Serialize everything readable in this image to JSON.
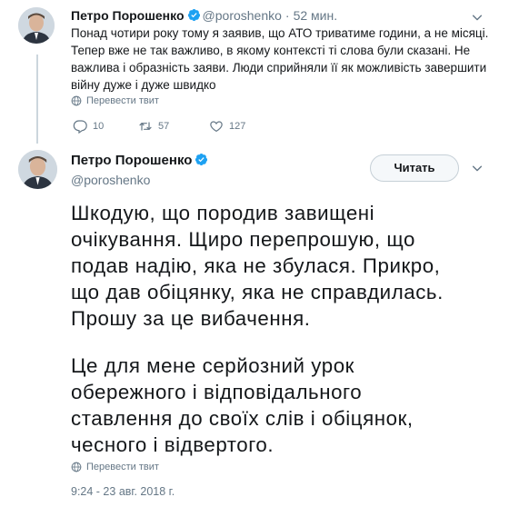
{
  "reply_tweet": {
    "author_name": "Петро Порошенко",
    "handle": "@poroshenko",
    "separator": "·",
    "time_ago": "52 мин.",
    "text_lines": [
      "Понад чотири року тому я заявив, що АТО триватиме години, а не місяці.",
      "Тепер вже не так важливо, в якому контексті ті слова були сказані. Не",
      "важлива і образність заяви. Люди сприйняли її як можливість завершити",
      "війну дуже і дуже швидко"
    ],
    "translate_label": "Перевести твит",
    "reply_count": "10",
    "retweet_count": "57",
    "like_count": "127"
  },
  "main_tweet": {
    "author_name": "Петро Порошенко",
    "handle": "@poroshenko",
    "follow_label": "Читать",
    "paragraph1_lines": [
      "Шкодую, що породив завищені",
      "очікування. Щиро перепрошую, що",
      "подав надію, яка не збулася. Прикро,",
      "що дав обіцянку, яка не справдилась.",
      "Прошу за це вибачення."
    ],
    "paragraph2_lines": [
      "Це для мене серйозний урок",
      "обережного і відповідального",
      "ставлення до своїх слів і обіцянок,",
      "чесного і відвертого."
    ],
    "translate_label": "Перевести твит",
    "timestamp": "9:24 - 23 авг. 2018 г."
  },
  "icons": {
    "verified": "verified-badge-icon",
    "chevron": "chevron-down-icon",
    "reply": "reply-icon",
    "retweet": "retweet-icon",
    "like": "heart-icon",
    "globe": "globe-icon"
  },
  "colors": {
    "verified_blue": "#1da1f2",
    "text_gray": "#657786",
    "thread_line": "#ccd6dd"
  }
}
